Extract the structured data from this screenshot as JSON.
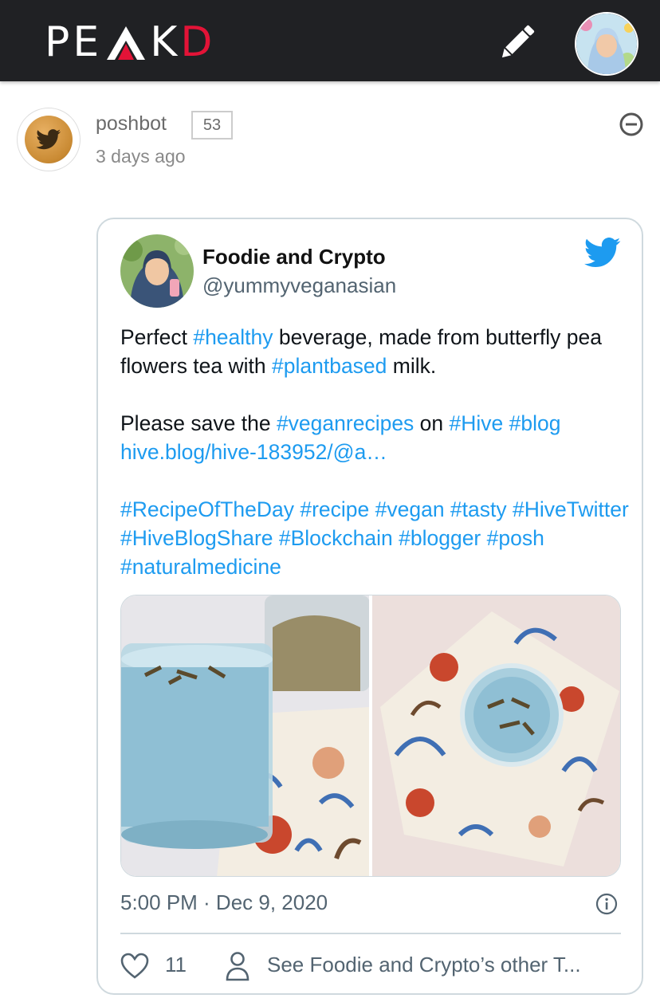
{
  "header": {
    "logo": {
      "p": "PE",
      "a": "A",
      "k": "K",
      "d": "D"
    },
    "brand_color": "#e31337",
    "icons": {
      "compose": "pencil-icon",
      "user": "user-avatar"
    }
  },
  "post": {
    "author": "poshbot",
    "reputation": "53",
    "time_ago": "3 days ago",
    "icons": {
      "collapse": "minus-circle-icon",
      "avatar": "twitter-bird-avatar"
    }
  },
  "tweet": {
    "name": "Foodie and Crypto",
    "handle": "@yummyveganasian",
    "text": {
      "l1_pre": "Perfect ",
      "l1_tag": "#healthy",
      "l1_post": " beverage, made from butterfly pea flowers tea with ",
      "l1_tag2": "#plantbased",
      "l1_end": " milk.",
      "l2_pre": "Please save the ",
      "l2_tag": "#veganrecipes",
      "l2_mid": " on ",
      "l2_tag2": "#Hive",
      "l2_tag3": "#blog",
      "link": "hive.blog/hive-183952/@a…",
      "tags": "#RecipeOfTheDay #recipe #vegan #tasty #HiveTwitter #HiveBlogShare #Blockchain #blogger #posh #naturalmedicine"
    },
    "timestamp": "5:00 PM · Dec 9, 2020",
    "likes": "11",
    "see_more": "See Foodie and Crypto’s other T...",
    "link_color": "#1d9bf0",
    "twitter_blue": "#1d9bf0"
  }
}
